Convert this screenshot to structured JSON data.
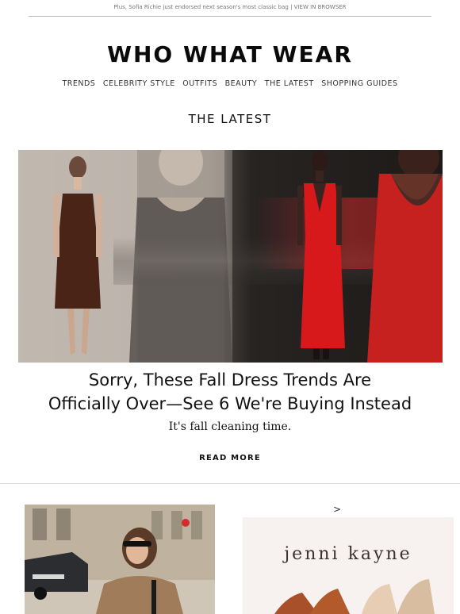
{
  "preheader": {
    "text": "Plus, Sofia Richie just endorsed next season's most classic bag |",
    "link": "VIEW IN BROWSER"
  },
  "brand": {
    "logo": "WHO WHAT WEAR"
  },
  "nav": {
    "items": [
      "TRENDS",
      "CELEBRITY STYLE",
      "OUTFITS",
      "BEAUTY",
      "THE LATEST",
      "SHOPPING GUIDES"
    ]
  },
  "section": {
    "title": "THE LATEST"
  },
  "feature": {
    "title_line1": "Sorry, These Fall Dress Trends Are",
    "title_line2": "Officially Over—See 6 We're Buying Instead",
    "subtitle": "It's fall cleaning time.",
    "cta": "READ MORE"
  },
  "next_row": {
    "arrow": ">",
    "right_brand": "jenni kayne"
  },
  "colors": {
    "accent_red": "#d9292b",
    "text": "#111111",
    "divider": "#e2e2e2"
  }
}
